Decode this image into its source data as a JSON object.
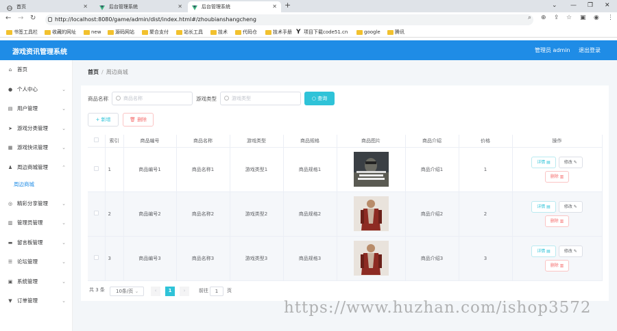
{
  "browser": {
    "tabs": [
      {
        "title": "首页"
      },
      {
        "title": "后台管理系统"
      },
      {
        "title": "后台管理系统"
      }
    ],
    "url": "http://localhost:8080/game/admin/dist/index.html#/zhoubianshangcheng",
    "bookmarks": [
      "书签工具栏",
      "收藏的网址",
      "new",
      "源码网站",
      "聚合支付",
      "站长工具",
      "技术",
      "代码仓",
      "技术手册",
      "项目下载code51.cn",
      "google",
      "腾讯"
    ]
  },
  "header": {
    "title": "游戏资讯管理系统",
    "user": "管理员 admin",
    "logout": "退出登录"
  },
  "sidebar": {
    "items": [
      {
        "label": "首页",
        "icon": "home-icon"
      },
      {
        "label": "个人中心",
        "icon": "user-icon"
      },
      {
        "label": "用户管理",
        "icon": "table-icon"
      },
      {
        "label": "游戏分类管理",
        "icon": "send-icon"
      },
      {
        "label": "游戏快讯管理",
        "icon": "grid-icon"
      },
      {
        "label": "周边商城管理",
        "icon": "person-icon"
      },
      {
        "label": "周边商城",
        "icon": ""
      },
      {
        "label": "精彩分享管理",
        "icon": "compass-icon"
      },
      {
        "label": "管理员管理",
        "icon": "chart-icon"
      },
      {
        "label": "留言板管理",
        "icon": "message-icon"
      },
      {
        "label": "论坛管理",
        "icon": "sliders-icon"
      },
      {
        "label": "系统管理",
        "icon": "system-icon"
      },
      {
        "label": "订单管理",
        "icon": "bookmark-icon"
      }
    ]
  },
  "breadcrumb": {
    "home": "首页",
    "current": "周边商城"
  },
  "search": {
    "name_label": "商品名称",
    "name_placeholder": "商品名称",
    "type_label": "游戏类型",
    "type_placeholder": "游戏类型",
    "query_button": "查询"
  },
  "actions": {
    "add": "新增",
    "delete": "删除"
  },
  "table": {
    "headers": [
      "索引",
      "商品编号",
      "商品名称",
      "游戏类型",
      "商品规格",
      "商品图片",
      "商品介绍",
      "价格",
      "操作"
    ],
    "rows": [
      {
        "index": "1",
        "code": "商品编号1",
        "name": "商品名称1",
        "type": "游戏类型1",
        "spec": "商品规格1",
        "image": "call-of-duty-cover",
        "intro": "商品介绍1",
        "price": "1"
      },
      {
        "index": "2",
        "code": "商品编号2",
        "name": "商品名称2",
        "type": "游戏类型2",
        "spec": "商品规格2",
        "image": "warrior-figure",
        "intro": "商品介绍2",
        "price": "2"
      },
      {
        "index": "3",
        "code": "商品编号3",
        "name": "商品名称3",
        "type": "游戏类型3",
        "spec": "商品规格3",
        "image": "warrior-figure",
        "intro": "商品介绍3",
        "price": "3"
      }
    ],
    "op_detail": "详情",
    "op_edit": "修改",
    "op_delete": "删除"
  },
  "pagination": {
    "total": "共 3 条",
    "page_size": "10条/页",
    "current": "1",
    "goto_label": "前往",
    "goto_value": "1",
    "page_unit": "页"
  },
  "watermark": "https://www.huzhan.com/ishop3572",
  "colors": {
    "primary": "#1f8ce6",
    "accent": "#2fc3d8",
    "danger": "#f56c6c"
  }
}
